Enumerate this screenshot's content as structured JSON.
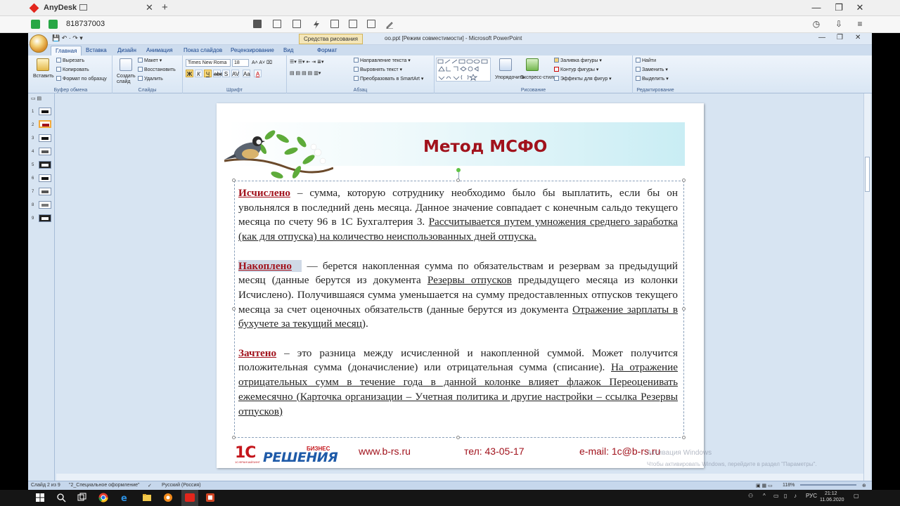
{
  "anydesk": {
    "app_name": "AnyDesk",
    "address": "818737003"
  },
  "ppt": {
    "context_tab": "Средства рисования",
    "doc_title": "оо.ppt [Режим совместимости] - Microsoft PowerPoint",
    "tabs": [
      "Главная",
      "Вставка",
      "Дизайн",
      "Анимация",
      "Показ слайдов",
      "Рецензирование",
      "Вид",
      "Формат"
    ],
    "ribbon": {
      "paste": "Вставить",
      "cut": "Вырезать",
      "copy": "Копировать",
      "format_painter": "Формат по образцу",
      "clipboard_label": "Буфер обмена",
      "new_slide": "Создать слайд",
      "layout": "Макет",
      "reset": "Восстановить",
      "delete": "Удалить",
      "slides_label": "Слайды",
      "font_name": "Times New Roma",
      "font_size": "18",
      "font_label": "Шрифт",
      "text_direction": "Направление текста",
      "align_text": "Выровнять текст",
      "smartart": "Преобразовать в SmartArt",
      "paragraph_label": "Абзац",
      "arrange": "Упорядочить",
      "quick_styles": "Экспресс-стили",
      "shape_fill": "Заливка фигуры",
      "shape_outline": "Контур фигуры",
      "shape_effects": "Эффекты для фигур",
      "drawing_label": "Рисование",
      "find": "Найти",
      "replace": "Заменить",
      "select": "Выделить",
      "editing_label": "Редактирование"
    },
    "slide_numbers": [
      "1",
      "2",
      "3",
      "4",
      "5",
      "6",
      "7",
      "8",
      "9"
    ],
    "slide": {
      "title": "Метод МСФО",
      "p1_kw": "Исчислено",
      "p1_a": " – сумма, которую сотруднику необходимо было бы выплатить, если бы он увольнялся в последний день месяца. Данное значение совпадает с конечным сальдо текущего месяца по счету 96 в 1С Бухгалтерия 3. ",
      "p1_ul": "Рассчитывается путем умножения среднего заработка (как для отпуска) на количество неиспользованных дней отпуска.",
      "p2_kw": "Накоплено",
      "p2_a": " — берется накопленная сумма по обязательствам и резервам за предыдущий месяц (данные берутся из документа ",
      "p2_ul1": "Резервы отпусков",
      "p2_b": " предыдущего месяца из колонки Исчислено). Получившаяся сумма уменьшается на сумму предоставленных отпусков текущего месяца за счет оценочных обязательств (данные берутся из документа ",
      "p2_ul2": "Отражение зарплаты в бухучете за текущий месяц",
      "p2_c": ").",
      "p3_kw": "Зачтено",
      "p3_a": " – это разница между исчисленной и накопленной суммой. Может получится положительная сумма (доначисление) или отрицательная сумма (списание). ",
      "p3_ul": "На отражение отрицательных сумм в течение года в данной колонке влияет флажок Переоценивать ежемесячно (Карточка организации – Учетная политика и другие настройки – ссылка Резервы отпусков)",
      "footer_logo_1c": "1С",
      "footer_logo_sub": "1С:ФРАНЧАЙЗИНГ",
      "footer_logo_biz": "БИЗНЕС",
      "footer_logo_name": "РЕШЕНИЯ",
      "footer_site": "www.b-rs.ru",
      "footer_phone": "тел: 43-05-17",
      "footer_email": "e-mail: 1c@b-rs.ru"
    },
    "watermark_line1": "Активация Windows",
    "watermark_line2": "Чтобы активировать Windows, перейдите в раздел \"Параметры\".",
    "status": {
      "slide_info": "Слайд 2 из 9",
      "theme": "\"2_Специальное оформление\"",
      "language": "Русский (Россия)",
      "zoom": "118%"
    }
  },
  "taskbar": {
    "lang": "РУС",
    "time": "21:12",
    "date": "11.06.2020"
  }
}
